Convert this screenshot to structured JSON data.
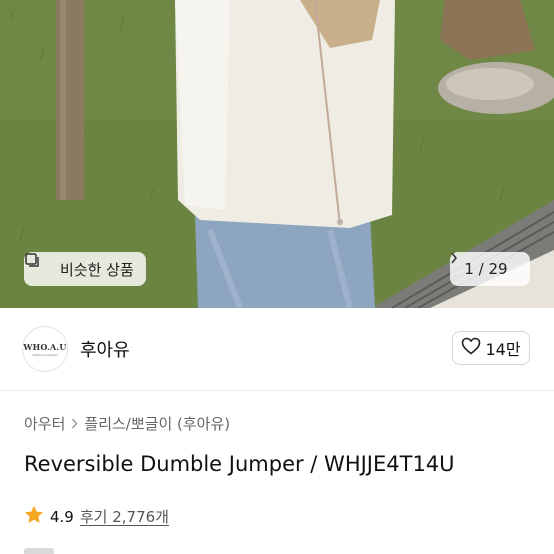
{
  "hero": {
    "similar_label": "비슷한 상품",
    "page_current": "1",
    "page_total": "29",
    "page_text": "1 / 29"
  },
  "seller": {
    "logo_text": "WHO.A.U",
    "logo_subtext": "California Dream",
    "name": "후아유",
    "likes": "14만"
  },
  "breadcrumb": [
    "아우터",
    "플리스/뽀글이 (후아유)"
  ],
  "product": {
    "title": "Reversible Dumble Jumper / WHJJE4T14U"
  },
  "rating": {
    "score": "4.9",
    "reviews": "후기 2,776개"
  },
  "colors": {
    "star": "#f5a623",
    "border": "#d8d8d8",
    "muted": "#666666"
  },
  "icons": {
    "similar": "square-stack-icon",
    "pager_next": "chevron-right-icon",
    "like": "heart-outline-icon",
    "breadcrumb_sep": "chevron-right-icon",
    "rating": "star-icon"
  }
}
